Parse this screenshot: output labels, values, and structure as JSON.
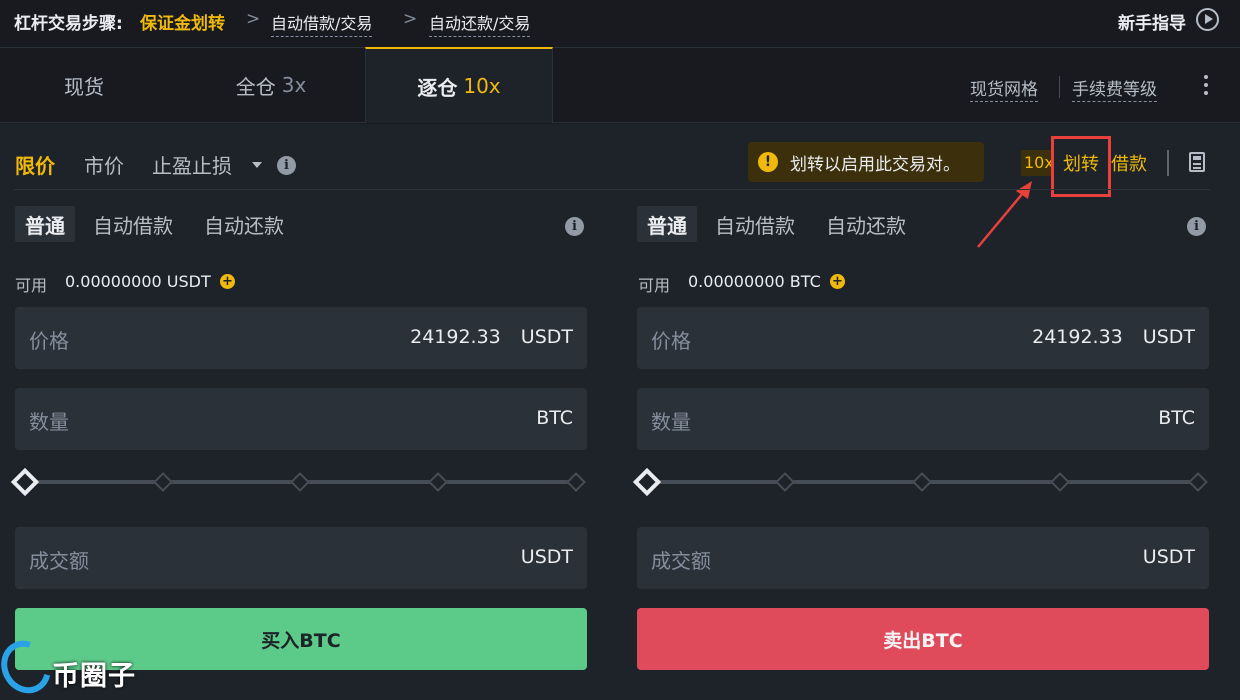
{
  "breadcrumb": {
    "title": "杠杆交易步骤:",
    "step1": "保证金划转",
    "sep": ">",
    "step2": "自动借款/交易",
    "step3": "自动还款/交易"
  },
  "guide": {
    "label": "新手指导",
    "icon": "play-circle-icon"
  },
  "tabs": [
    {
      "label": "现货",
      "leverage": ""
    },
    {
      "label": "全仓",
      "leverage": "3x"
    },
    {
      "label": "逐仓",
      "leverage": "10x",
      "active": true
    }
  ],
  "top_links": {
    "grid": "现货网格",
    "fee_level": "手续费等级"
  },
  "order_types": {
    "limit": "限价",
    "market": "市价",
    "stop": "止盈止损"
  },
  "tooltip": {
    "icon": "!",
    "text": "划转以启用此交易对。"
  },
  "margin_actions": {
    "leverage": "10x",
    "transfer": "划转",
    "borrow": "借款"
  },
  "mode_tabs": {
    "normal": "普通",
    "auto_borrow": "自动借款",
    "auto_repay": "自动还款"
  },
  "buy_panel": {
    "available_label": "可用",
    "available_value": "0.00000000 USDT",
    "price_label": "价格",
    "price_value": "24192.33",
    "price_unit": "USDT",
    "amount_label": "数量",
    "amount_unit": "BTC",
    "total_label": "成交额",
    "total_unit": "USDT",
    "button": "买入BTC",
    "slider_value": 0
  },
  "sell_panel": {
    "available_label": "可用",
    "available_value": "0.00000000 BTC",
    "price_label": "价格",
    "price_value": "24192.33",
    "price_unit": "USDT",
    "amount_label": "数量",
    "amount_unit": "BTC",
    "total_label": "成交额",
    "total_unit": "USDT",
    "button": "卖出BTC",
    "slider_value": 0
  },
  "watermark": "币圈子",
  "colors": {
    "accent": "#f0b90b",
    "buy": "#5cca88",
    "sell": "#e04b5c",
    "highlight_box": "#e8403a",
    "background": "#1e2329"
  }
}
